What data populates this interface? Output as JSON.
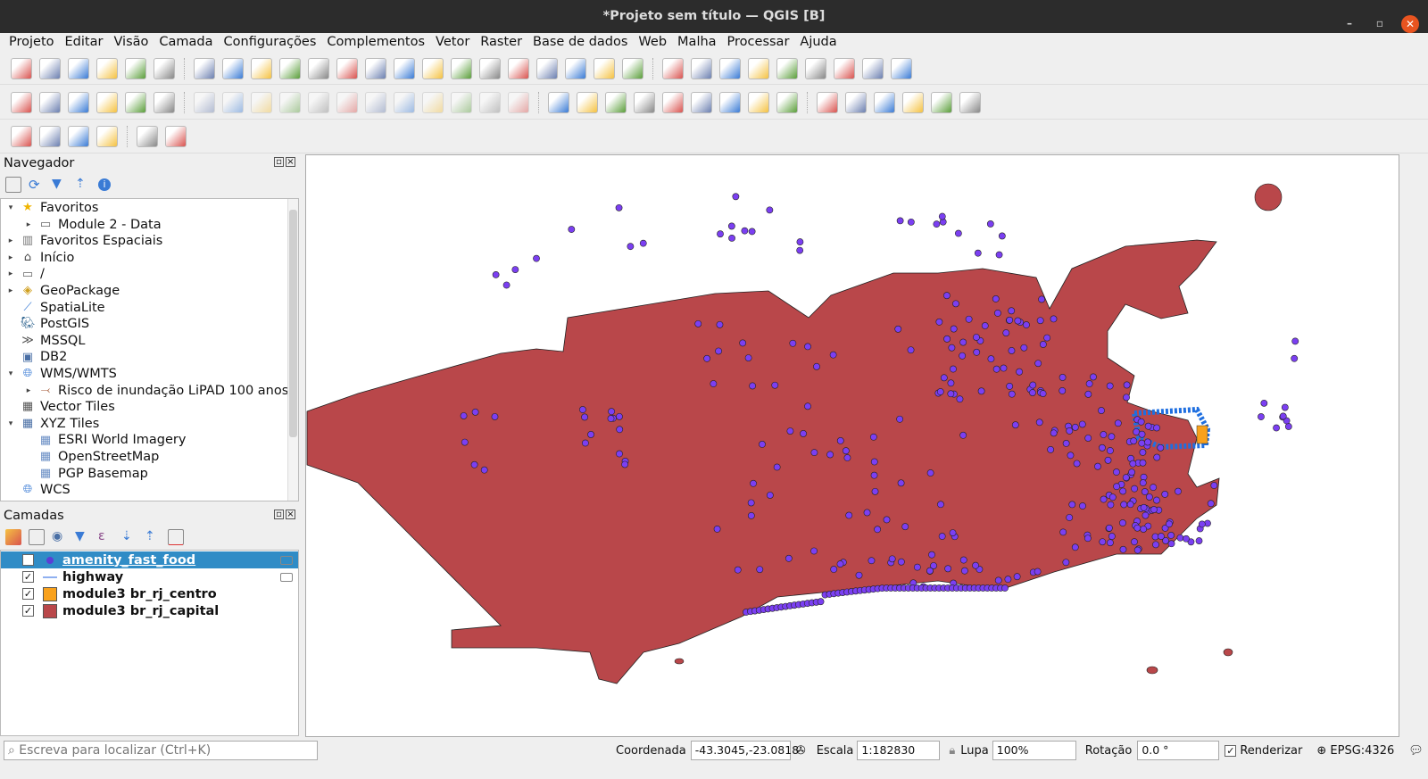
{
  "window": {
    "title": "*Projeto sem título — QGIS [B]",
    "minimize": "–",
    "maximize": "▫",
    "close": "✕"
  },
  "menu": [
    "Projeto",
    "Editar",
    "Visão",
    "Camada",
    "Configurações",
    "Complementos",
    "Vetor",
    "Raster",
    "Base de dados",
    "Web",
    "Malha",
    "Processar",
    "Ajuda"
  ],
  "toolbars": {
    "row1": [
      "new-project-icon",
      "open-project-icon",
      "save-project-icon",
      "new-print-layout-icon",
      "layout-manager-icon",
      "style-manager-icon",
      "|",
      "pan-icon",
      "pan-to-selection-icon",
      "zoom-in-icon",
      "zoom-out-icon",
      "zoom-full-icon",
      "zoom-to-selection-icon",
      "zoom-to-layer-icon",
      "zoom-native-icon",
      "zoom-last-icon",
      "zoom-next-icon",
      "new-map-view-icon",
      "new-3d-view-icon",
      "bookmark-icon",
      "show-bookmarks-icon",
      "temporal-controller-icon",
      "refresh-icon",
      "|",
      "identify-icon",
      "attribute-table-icon",
      "field-calculator-icon",
      "processing-toolbox-icon",
      "statistics-icon",
      "measure-icon",
      "map-tips-icon",
      "zoom-tools-icon",
      "text-annotation-icon"
    ],
    "row2": [
      "add-vector-layer-icon",
      "add-geopackage-icon",
      "add-delimited-text-icon",
      "add-spatialite-icon",
      "add-virtual-layer-icon",
      "new-shapefile-icon",
      "|",
      "current-edits-icon",
      "toggle-editing-icon",
      "save-edits-icon",
      "add-feature-icon",
      "vertex-tool-icon",
      "modify-attributes-icon",
      "delete-selected-icon",
      "cut-icon",
      "copy-icon",
      "paste-icon",
      "undo-icon",
      "redo-icon",
      "|",
      "label-tool-icon",
      "diagram-icon",
      "label-pin-icon",
      "label-highlight-icon",
      "pin-labels-icon",
      "show-hide-labels-icon",
      "move-label-icon",
      "rotate-label-icon",
      "change-label-icon",
      "|",
      "metasearch-icon",
      "wms-icon",
      "quickmapservices-icon",
      "python-console-icon",
      "globe-icon",
      "help-icon"
    ],
    "row3": [
      "select-features-icon",
      "select-by-value-icon",
      "deselect-icon",
      "select-by-location-icon",
      "|",
      "locator-icon",
      "georeferencer-icon"
    ]
  },
  "browser": {
    "title": "Navegador",
    "items": [
      {
        "label": "Favoritos",
        "icon": "star-icon",
        "level": 0,
        "arrow": "▾"
      },
      {
        "label": "Module 2 - Data",
        "icon": "folder-icon",
        "level": 1,
        "arrow": "▸"
      },
      {
        "label": "Favoritos Espaciais",
        "icon": "spatial-bookmarks-icon",
        "level": 0,
        "arrow": "▸"
      },
      {
        "label": "Início",
        "icon": "home-icon",
        "level": 0,
        "arrow": "▸"
      },
      {
        "label": "/",
        "icon": "folder-icon",
        "level": 0,
        "arrow": "▸"
      },
      {
        "label": "GeoPackage",
        "icon": "geopackage-icon",
        "level": 0,
        "arrow": "▸"
      },
      {
        "label": "SpatiaLite",
        "icon": "spatialite-icon",
        "level": 0,
        "arrow": ""
      },
      {
        "label": "PostGIS",
        "icon": "postgis-icon",
        "level": 0,
        "arrow": ""
      },
      {
        "label": "MSSQL",
        "icon": "mssql-icon",
        "level": 0,
        "arrow": ""
      },
      {
        "label": "DB2",
        "icon": "db2-icon",
        "level": 0,
        "arrow": ""
      },
      {
        "label": "WMS/WMTS",
        "icon": "wms-icon",
        "level": 0,
        "arrow": "▾"
      },
      {
        "label": "Risco de inundação LiPAD 100 anos",
        "icon": "wms-layer-icon",
        "level": 1,
        "arrow": "▸"
      },
      {
        "label": "Vector Tiles",
        "icon": "vector-tiles-icon",
        "level": 0,
        "arrow": ""
      },
      {
        "label": "XYZ Tiles",
        "icon": "xyz-tiles-icon",
        "level": 0,
        "arrow": "▾"
      },
      {
        "label": "ESRI World Imagery",
        "icon": "tile-icon",
        "level": 1,
        "arrow": ""
      },
      {
        "label": "OpenStreetMap",
        "icon": "tile-icon",
        "level": 1,
        "arrow": ""
      },
      {
        "label": "PGP Basemap",
        "icon": "tile-icon",
        "level": 1,
        "arrow": ""
      },
      {
        "label": "WCS",
        "icon": "wcs-icon",
        "level": 0,
        "arrow": ""
      }
    ]
  },
  "layers": {
    "title": "Camadas",
    "items": [
      {
        "label": "amenity_fast_food",
        "symbol": "point",
        "color": "#5a3fd6",
        "checked": true,
        "selected": true
      },
      {
        "label": "highway",
        "symbol": "line",
        "color": "#8fb0f0",
        "checked": true,
        "selected": false
      },
      {
        "label": "module3 br_rj_centro",
        "symbol": "fill",
        "color": "#f9a11b",
        "checked": true,
        "selected": false
      },
      {
        "label": "module3 br_rj_capital",
        "symbol": "fill",
        "color": "#b9474a",
        "checked": true,
        "selected": false
      }
    ]
  },
  "map": {
    "fill_color": "#b9474a",
    "point_color": "#7b3ff2",
    "highway_color": "#1f6fe0",
    "centro_color": "#f9a11b"
  },
  "status": {
    "search_placeholder": "Escreva para localizar (Ctrl+K)",
    "coord_label": "Coordenada",
    "coord_value": "-43.3045,-23.0818",
    "scale_label": "Escala",
    "scale_value": "1:182830",
    "magnifier_label": "Lupa",
    "magnifier_value": "100%",
    "rotation_label": "Rotação",
    "rotation_value": "0.0 °",
    "render_label": "Renderizar",
    "render_checked": true,
    "crs": "EPSG:4326"
  }
}
